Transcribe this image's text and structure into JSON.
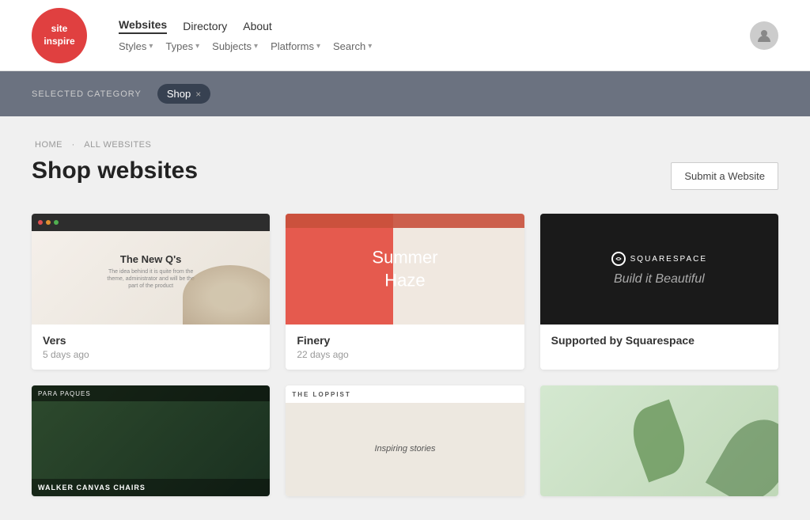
{
  "header": {
    "logo": {
      "line1": "site",
      "line2": "inspire"
    },
    "nav_primary": [
      {
        "label": "Websites",
        "active": true
      },
      {
        "label": "Directory",
        "active": false
      },
      {
        "label": "About",
        "active": false
      }
    ],
    "nav_secondary": [
      {
        "label": "Styles",
        "has_arrow": true
      },
      {
        "label": "Types",
        "has_arrow": true
      },
      {
        "label": "Subjects",
        "has_arrow": true
      },
      {
        "label": "Platforms",
        "has_arrow": true
      },
      {
        "label": "Search",
        "has_arrow": true
      }
    ]
  },
  "category_bar": {
    "label": "SELECTED CATEGORY",
    "tag": "Shop"
  },
  "breadcrumb": {
    "home": "HOME",
    "separator": "·",
    "section": "ALL WEBSITES"
  },
  "page": {
    "title": "Shop websites",
    "submit_button": "Submit a Website"
  },
  "cards": [
    {
      "id": "vers",
      "title": "Vers",
      "date": "5 days ago"
    },
    {
      "id": "finery",
      "title": "Finery",
      "date": "22 days ago"
    },
    {
      "id": "squarespace",
      "title": "Supported by Squarespace",
      "date": "",
      "sponsored": true
    },
    {
      "id": "bottom1",
      "title": "",
      "date": "",
      "bottom": true
    },
    {
      "id": "bottom2",
      "title": "",
      "date": "",
      "bottom": true
    },
    {
      "id": "bottom3",
      "title": "",
      "date": "",
      "bottom": true
    }
  ],
  "thumb_vers": {
    "title": "The New Q's",
    "subtitle": "The idea behind it is quite from the theme, administrator and will be the part of the product"
  },
  "thumb_finery": {
    "line1": "Summer",
    "line2": "Haze"
  },
  "thumb_squarespace": {
    "logo": "SQUARESPACE",
    "tagline": "Build it Beautiful"
  },
  "thumb_bottom1": {
    "site_name": "PARA PAQUES",
    "bottom_text": "WALKER CANVAS CHAIRS"
  },
  "thumb_bottom2": {
    "site_name": "THE LOPPIST",
    "subtitle": "Inspiring stories"
  }
}
